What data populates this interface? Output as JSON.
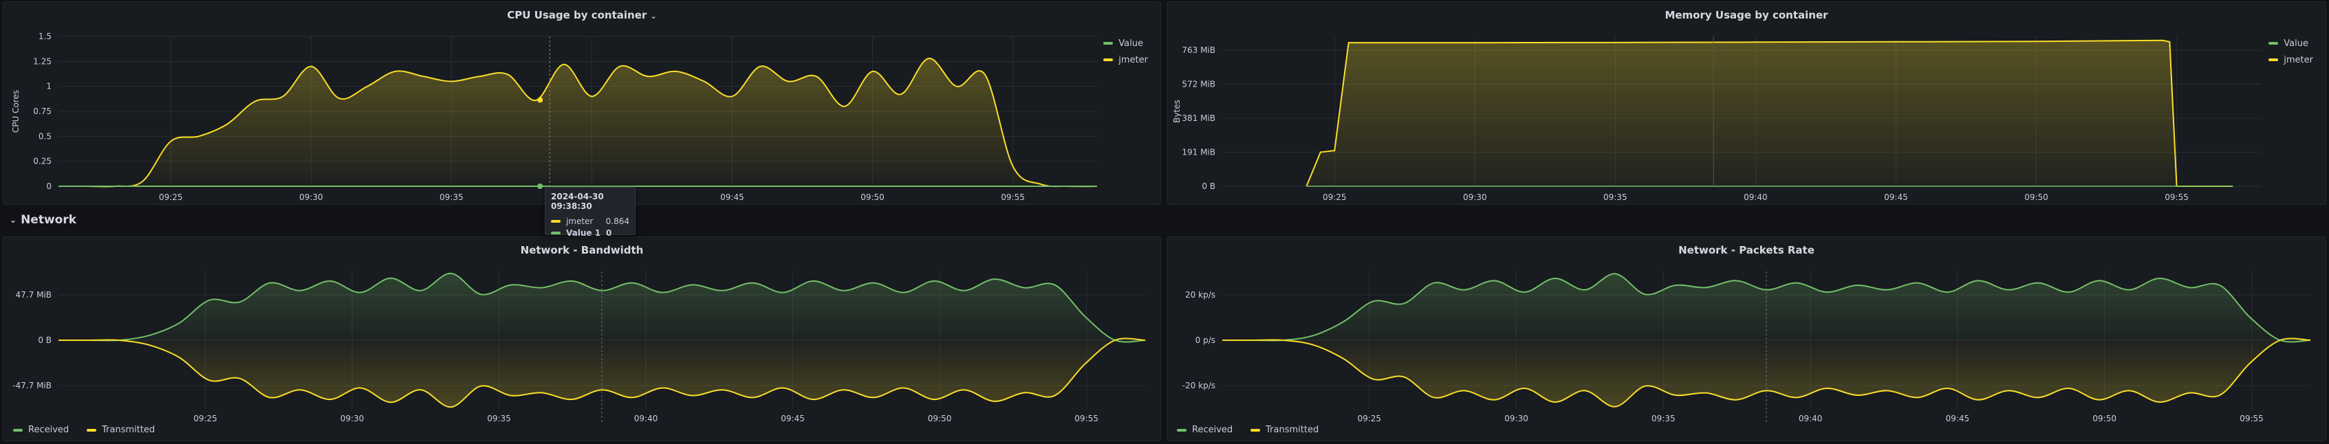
{
  "colors": {
    "green": "#73bf69",
    "yellow": "#fade2a"
  },
  "cpu": {
    "title": "CPU Usage by container",
    "ylabel": "CPU Cores",
    "legend": [
      "Value",
      "jmeter"
    ]
  },
  "memory": {
    "title": "Memory Usage by container",
    "ylabel": "Bytes",
    "legend": [
      "Value",
      "jmeter"
    ]
  },
  "row": {
    "title": "Network"
  },
  "bandwidth": {
    "title": "Network - Bandwidth",
    "legend": [
      "Received",
      "Transmitted"
    ]
  },
  "packets": {
    "title": "Network - Packets Rate",
    "legend": [
      "Received",
      "Transmitted"
    ]
  },
  "tooltip": {
    "time": "2024-04-30 09:38:30",
    "rows": [
      {
        "name": "jmeter",
        "value": "0.864"
      },
      {
        "name": "Value 1",
        "value": "0"
      }
    ]
  },
  "chart_data": [
    {
      "type": "area",
      "title": "CPU Usage by container",
      "ylabel": "CPU Cores",
      "ylim": [
        0,
        1.5
      ],
      "yticks": [
        "0",
        "0.25",
        "0.5",
        "0.75",
        "1",
        "1.25",
        "1.5"
      ],
      "xticks": [
        "09:25",
        "09:30",
        "09:35",
        "09:40",
        "09:45",
        "09:50",
        "09:55"
      ],
      "x": [
        "09:21",
        "09:22",
        "09:23",
        "09:24",
        "09:25",
        "09:26",
        "09:27",
        "09:28",
        "09:29",
        "09:30",
        "09:31",
        "09:32",
        "09:33",
        "09:34",
        "09:35",
        "09:36",
        "09:37",
        "09:38",
        "09:39",
        "09:40",
        "09:41",
        "09:42",
        "09:43",
        "09:44",
        "09:45",
        "09:46",
        "09:47",
        "09:48",
        "09:49",
        "09:50",
        "09:51",
        "09:52",
        "09:53",
        "09:54",
        "09:55",
        "09:56",
        "09:57",
        "09:58"
      ],
      "series": [
        {
          "name": "jmeter",
          "values": [
            0,
            0,
            0,
            0.05,
            0.45,
            0.5,
            0.62,
            0.85,
            0.9,
            1.2,
            0.88,
            1.0,
            1.15,
            1.1,
            1.05,
            1.1,
            1.12,
            0.86,
            1.22,
            0.9,
            1.2,
            1.1,
            1.15,
            1.05,
            0.9,
            1.2,
            1.05,
            1.1,
            0.8,
            1.15,
            0.92,
            1.28,
            1.0,
            1.12,
            0.2,
            0.02,
            0,
            0
          ]
        },
        {
          "name": "Value",
          "values": [
            0,
            0,
            0,
            0,
            0,
            0,
            0,
            0,
            0,
            0,
            0,
            0,
            0,
            0,
            0,
            0,
            0,
            0,
            0,
            0,
            0,
            0,
            0,
            0,
            0,
            0,
            0,
            0,
            0,
            0,
            0,
            0,
            0,
            0,
            0,
            0,
            0,
            0
          ]
        }
      ]
    },
    {
      "type": "area",
      "title": "Memory Usage by container",
      "ylabel": "Bytes",
      "ylim": [
        0,
        840
      ],
      "yticks": [
        "0 B",
        "191 MiB",
        "381 MiB",
        "572 MiB",
        "763 MiB"
      ],
      "xticks": [
        "09:25",
        "09:30",
        "09:35",
        "09:40",
        "09:45",
        "09:50",
        "09:55"
      ],
      "x": [
        "09:24",
        "09:24:30",
        "09:25",
        "09:25:30",
        "09:30",
        "09:35",
        "09:40",
        "09:45",
        "09:50",
        "09:54:30",
        "09:54:45",
        "09:55",
        "09:57"
      ],
      "series": [
        {
          "name": "jmeter",
          "values": [
            0,
            191,
            200,
            805,
            805,
            806,
            808,
            810,
            812,
            818,
            810,
            0,
            0
          ]
        },
        {
          "name": "Value",
          "values": [
            0,
            0,
            0,
            0,
            0,
            0,
            0,
            0,
            0,
            0,
            0,
            0,
            0
          ]
        }
      ]
    },
    {
      "type": "area",
      "title": "Network - Bandwidth",
      "yticks": [
        "47.7 MiB",
        "0 B",
        "-47.7 MiB"
      ],
      "ylim": [
        -72,
        72
      ],
      "xticks": [
        "09:25",
        "09:30",
        "09:35",
        "09:40",
        "09:45",
        "09:50",
        "09:55"
      ],
      "series": [
        {
          "name": "Received",
          "values": [
            0,
            0,
            0,
            5,
            18,
            42,
            40,
            60,
            52,
            62,
            50,
            65,
            52,
            70,
            48,
            58,
            55,
            62,
            52,
            60,
            50,
            58,
            52,
            60,
            50,
            62,
            52,
            60,
            50,
            62,
            52,
            64,
            55,
            58,
            25,
            0,
            0
          ]
        },
        {
          "name": "Transmitted",
          "values": [
            0,
            0,
            0,
            -5,
            -18,
            -42,
            -40,
            -60,
            -52,
            -62,
            -50,
            -65,
            -52,
            -70,
            -48,
            -58,
            -55,
            -62,
            -52,
            -60,
            -50,
            -58,
            -52,
            -60,
            -50,
            -62,
            -52,
            -60,
            -50,
            -62,
            -52,
            -64,
            -55,
            -58,
            -25,
            0,
            0
          ]
        }
      ]
    },
    {
      "type": "area",
      "title": "Network - Packets Rate",
      "yticks": [
        "20 kp/s",
        "0 p/s",
        "-20 kp/s"
      ],
      "ylim": [
        -30,
        30
      ],
      "xticks": [
        "09:25",
        "09:30",
        "09:35",
        "09:40",
        "09:45",
        "09:50",
        "09:55"
      ],
      "series": [
        {
          "name": "Received",
          "values": [
            0,
            0,
            0,
            2,
            8,
            17,
            16,
            25,
            22,
            26,
            21,
            27,
            22,
            29,
            20,
            24,
            23,
            26,
            22,
            25,
            21,
            24,
            22,
            25,
            21,
            26,
            22,
            25,
            21,
            26,
            22,
            27,
            23,
            24,
            10,
            0,
            0
          ]
        },
        {
          "name": "Transmitted",
          "values": [
            0,
            0,
            0,
            -2,
            -8,
            -17,
            -16,
            -25,
            -22,
            -26,
            -21,
            -27,
            -22,
            -29,
            -20,
            -24,
            -23,
            -26,
            -22,
            -25,
            -21,
            -24,
            -22,
            -25,
            -21,
            -26,
            -22,
            -25,
            -21,
            -26,
            -22,
            -27,
            -23,
            -24,
            -10,
            0,
            0
          ]
        }
      ]
    }
  ]
}
